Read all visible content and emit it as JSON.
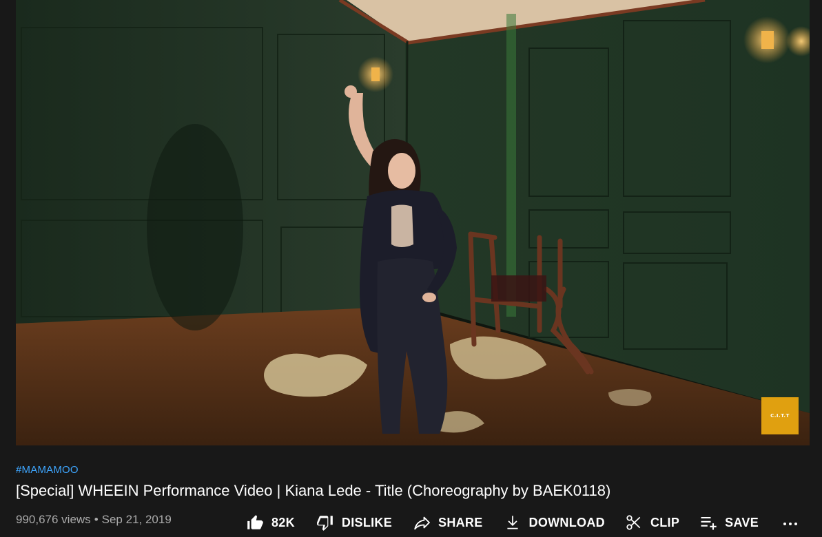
{
  "video": {
    "watermark_text": "C.I.T.T"
  },
  "hashtag": "#MAMAMOO",
  "title": "[Special] WHEEIN Performance Video | Kiana Lede - Title (Choreography by BAEK0118)",
  "views": "990,676 views",
  "separator": "•",
  "date": "Sep 21, 2019",
  "actions": {
    "like_count": "82K",
    "dislike_label": "DISLIKE",
    "share_label": "SHARE",
    "download_label": "DOWNLOAD",
    "clip_label": "CLIP",
    "save_label": "SAVE",
    "more_label": "..."
  },
  "colors": {
    "background": "#181818",
    "link_blue": "#3ea6ff",
    "meta_gray": "#aaaaaa",
    "watermark": "#e0a010"
  },
  "icons": [
    "like-icon",
    "dislike-icon",
    "share-icon",
    "download-icon",
    "clip-icon",
    "save-playlist-icon",
    "more-options-icon"
  ]
}
